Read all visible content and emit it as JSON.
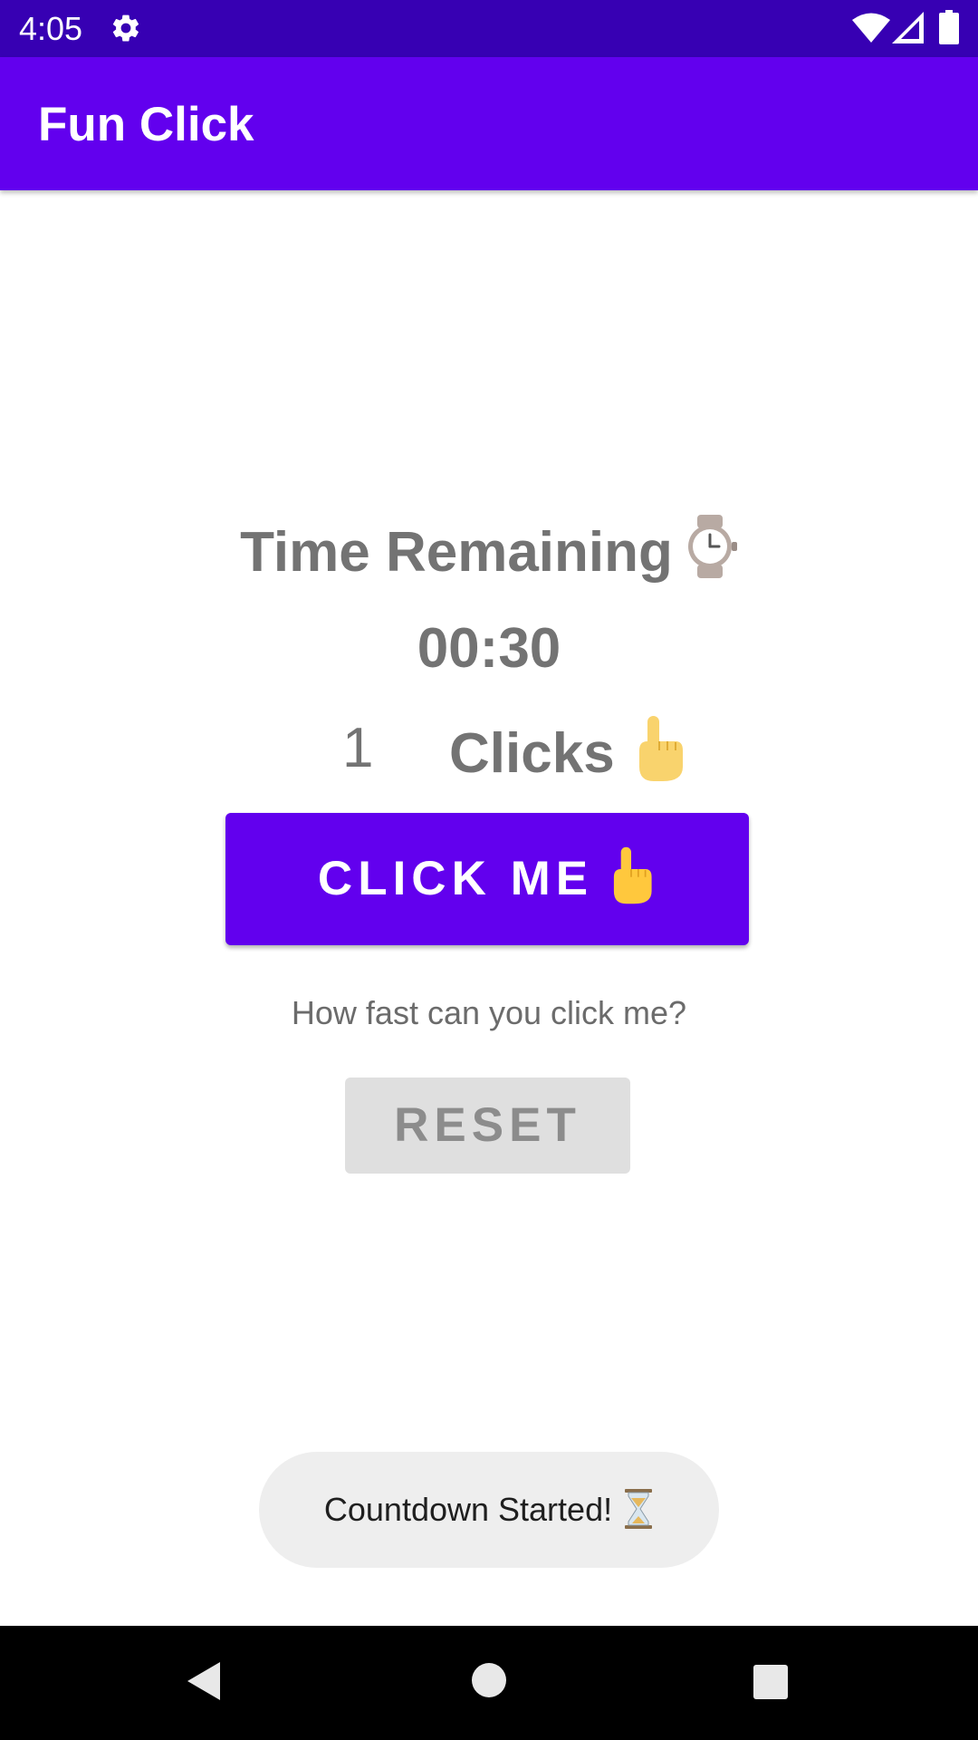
{
  "status_bar": {
    "time": "4:05",
    "icons": [
      "gear-icon",
      "wifi-icon",
      "signal-icon",
      "battery-icon"
    ]
  },
  "app_bar": {
    "title": "Fun Click"
  },
  "main": {
    "time_label": "Time Remaining",
    "time_label_icon": "watch-icon",
    "timer_value": "00:30",
    "click_count": "1",
    "clicks_label": "Clicks",
    "clicks_icon": "pointing-hand-icon",
    "click_button_label": "CLICK ME",
    "click_button_icon": "pointing-hand-icon",
    "hint": "How fast can you click me?",
    "reset_button_label": "RESET"
  },
  "toast": {
    "message": "Countdown Started!",
    "icon": "hourglass-icon"
  },
  "nav_bar": {
    "icons": [
      "back-icon",
      "home-icon",
      "recents-icon"
    ]
  },
  "colors": {
    "status_bar": "#3700b3",
    "app_bar": "#6200ee",
    "primary_button": "#6200ee",
    "disabled_button": "#dfdfdf",
    "body_text": "#737373",
    "toast_background": "#eeeeee"
  }
}
